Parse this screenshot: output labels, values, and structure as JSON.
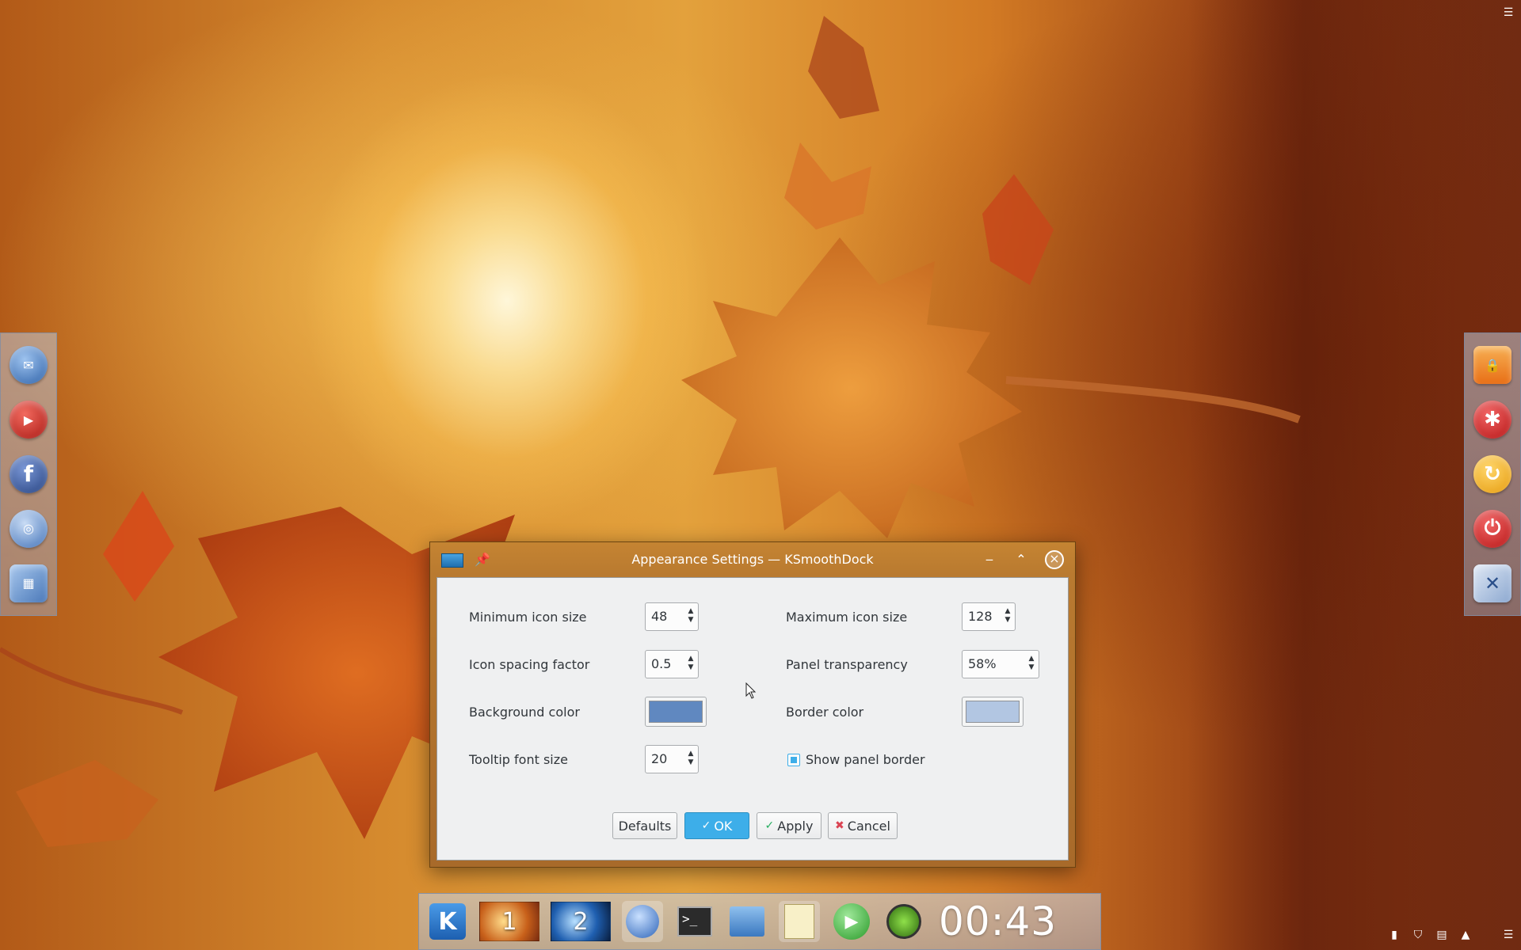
{
  "desktop": {
    "corner_menu_icon": "hamburger-icon",
    "left_dock": [
      {
        "name": "mail-icon",
        "color": "#4a7fc1"
      },
      {
        "name": "youtube-icon",
        "color": "#c4211b"
      },
      {
        "name": "facebook-icon",
        "color": "#3b5998"
      },
      {
        "name": "network-globe-icon",
        "color": "#5a8fd0"
      },
      {
        "name": "photo-viewer-icon",
        "color": "#6a9ad0"
      }
    ],
    "right_dock": [
      {
        "name": "lock-screen-icon",
        "color": "#f08a24"
      },
      {
        "name": "switch-user-icon",
        "color": "#d62020"
      },
      {
        "name": "refresh-icon",
        "color": "#f2b019"
      },
      {
        "name": "shutdown-icon",
        "color": "#d62020"
      },
      {
        "name": "system-settings-icon",
        "color": "#3a6fb4"
      }
    ]
  },
  "dialog": {
    "title": "Appearance Settings — KSmoothDock",
    "fields": {
      "min_icon_size_label": "Minimum icon size",
      "min_icon_size_value": "48",
      "max_icon_size_label": "Maximum icon size",
      "max_icon_size_value": "128",
      "icon_spacing_label": "Icon spacing factor",
      "icon_spacing_value": "0.5",
      "panel_transparency_label": "Panel transparency",
      "panel_transparency_value": "58%",
      "background_color_label": "Background color",
      "background_color": "#6088c0",
      "border_color_label": "Border color",
      "border_color": "#b2c6e2",
      "tooltip_font_label": "Tooltip font size",
      "tooltip_font_value": "20",
      "show_border_label": "Show panel border",
      "show_border_checked": true
    },
    "buttons": {
      "defaults": "Defaults",
      "ok": "OK",
      "apply": "Apply",
      "cancel": "Cancel"
    }
  },
  "taskbar": {
    "desktop_1": "1",
    "desktop_2": "2",
    "clock": "00:43"
  }
}
